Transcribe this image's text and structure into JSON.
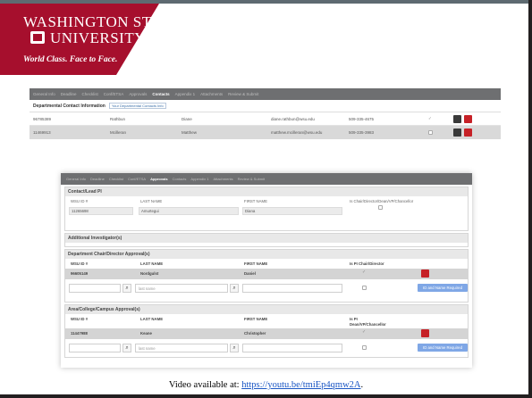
{
  "header": {
    "univ_line1": "WASHINGTON STATE",
    "univ_line2": "UNIVERSITY",
    "tagline": "World Class. Face to Face.",
    "colors": {
      "crimson": "#a60f2d",
      "gray": "#5e6a71"
    }
  },
  "shot1": {
    "nav": [
      "General Info",
      "Deadline",
      "Checklist",
      "Conf/ETSA",
      "Approvals",
      "Contacts",
      "Appendix 1",
      "Attachments",
      "Review & Submit"
    ],
    "active_nav": "Contacts",
    "section_title": "Departmental Contact Information",
    "section_button": "Your Departmental Contacts Info",
    "rows": [
      {
        "id": "96785389",
        "last": "Rathbun",
        "first": "Diane",
        "email": "diane.rathbun@wsu.edu",
        "phone": "509-335-4675",
        "mark": "✓"
      },
      {
        "id": "11469913",
        "last": "Mcilleran",
        "first": "Matthew",
        "email": "matthew.mcilleran@wsu.edu",
        "phone": "509-335-3983",
        "mark": ""
      }
    ]
  },
  "shot2": {
    "nav": [
      "General Info",
      "Deadline",
      "Checklist",
      "Conf/ETSA",
      "Approvals",
      "Contacts",
      "Appendix 1",
      "Attachments",
      "Review & Submit"
    ],
    "active_nav": "Approvals",
    "lead": {
      "title": "Contact/Lead PI",
      "h_id": "WSU ID #",
      "h_last": "LAST NAME",
      "h_first": "FIRST NAME",
      "h_chair": "Is Chair/Director/Dean/VP/Chancellor",
      "id": "11265698",
      "last": "Amurtegui",
      "first": "Diana"
    },
    "additional_title": "Additional Investigator(s)",
    "dept": {
      "title": "Department Chair/Director Approval(s)",
      "h_id": "WSU ID #",
      "h_last": "LAST NAME",
      "h_first": "FIRST NAME",
      "h_flag": "Is PI Chair/Director",
      "id": "96605149",
      "last": "Nordgulst",
      "first": "Daniel",
      "check": "✓",
      "last_placeholder": "last name",
      "button": "ID and Name Required"
    },
    "area": {
      "title": "Area/College/Campus Approval(s)",
      "h_id": "WSU ID #",
      "h_last": "LAST NAME",
      "h_first": "FIRST NAME",
      "h_flag1": "Is PI",
      "h_flag2": "Dean/VP/Chancellor",
      "id": "11447988",
      "last": "Keane",
      "first": "Christopher",
      "check": "✓",
      "last_placeholder": "last name",
      "button": "ID and Name Required"
    }
  },
  "footer": {
    "text": "Video available at: ",
    "link": "https://youtu.be/tmiEp4qmw2A",
    "suffix": "."
  }
}
